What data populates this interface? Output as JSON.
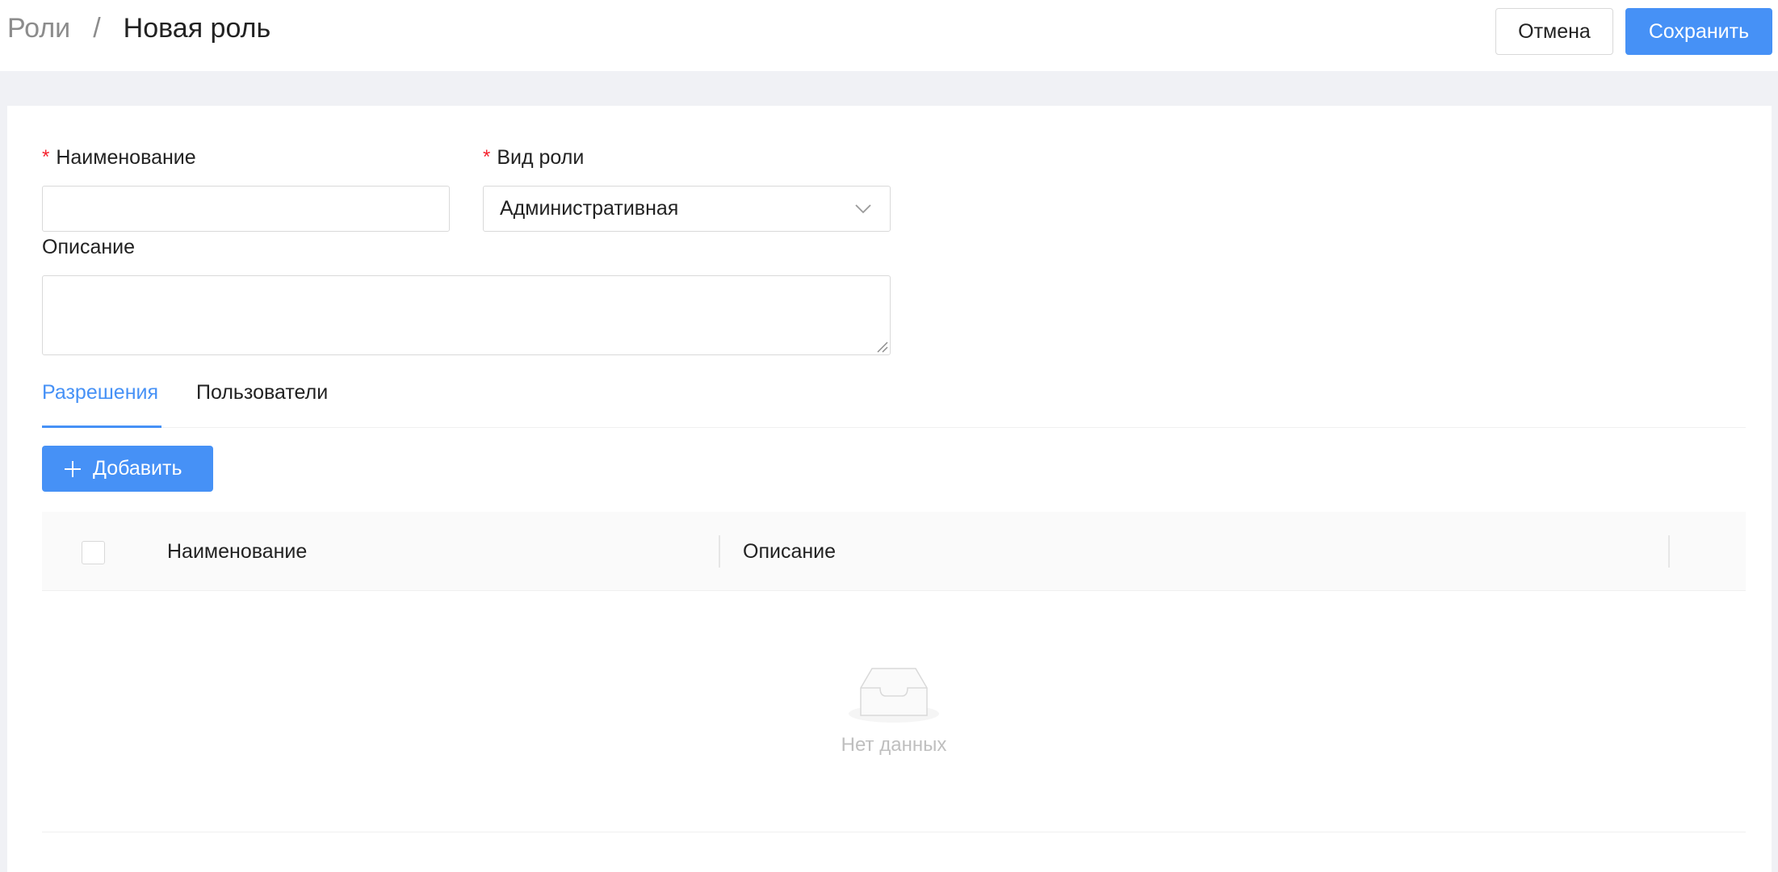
{
  "header": {
    "breadcrumb_parent": "Роли",
    "breadcrumb_separator": "/",
    "page_title": "Новая роль",
    "cancel_label": "Отмена",
    "save_label": "Сохранить"
  },
  "form": {
    "name": {
      "label": "Наименование",
      "required_mark": "*",
      "value": ""
    },
    "role_type": {
      "label": "Вид роли",
      "required_mark": "*",
      "value": "Административная"
    },
    "description": {
      "label": "Описание",
      "value": ""
    }
  },
  "tabs": [
    {
      "label": "Разрешения",
      "active": true
    },
    {
      "label": "Пользователи",
      "active": false
    }
  ],
  "permissions": {
    "add_label": "Добавить",
    "columns": [
      "Наименование",
      "Описание"
    ],
    "empty_text": "Нет данных"
  },
  "colors": {
    "primary": "#4691f6",
    "required": "#f5222d",
    "page_bg": "#f0f1f5"
  },
  "icons": {
    "select_arrow": "chevron-down-icon",
    "add": "plus-icon",
    "empty": "empty-inbox-icon"
  }
}
